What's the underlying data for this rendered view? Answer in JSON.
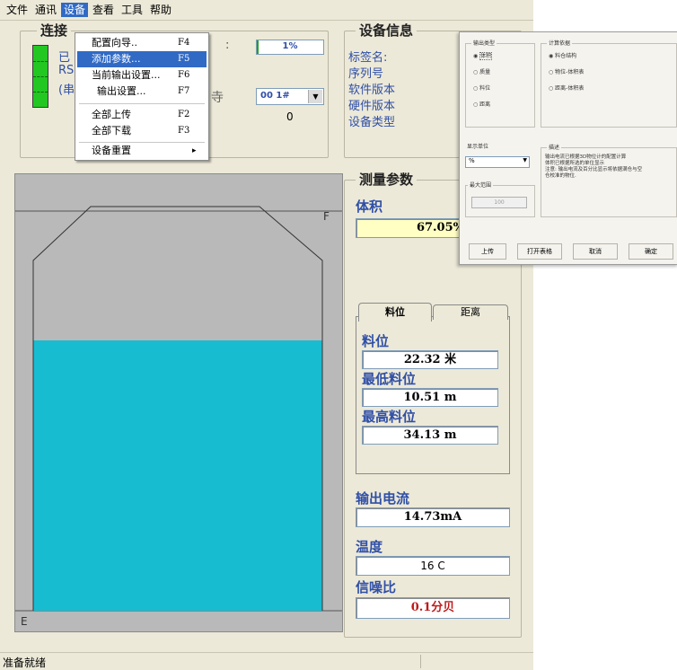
{
  "menubar": {
    "items": [
      "文件",
      "通讯",
      "设备",
      "查看",
      "工具",
      "帮助"
    ]
  },
  "device_menu": {
    "items": [
      {
        "label": "配置向导..",
        "key": "F4"
      },
      {
        "label": "添加参数...",
        "key": "F5"
      },
      {
        "label": "当前输出设置...",
        "key": "F6"
      },
      {
        "label": "输出设置...",
        "key": "F7"
      },
      {
        "label": "全部上传",
        "key": "F2"
      },
      {
        "label": "全部下载",
        "key": "F3"
      },
      {
        "label": "设备重置",
        "key": "▸"
      }
    ]
  },
  "connection": {
    "title": "连接",
    "line1": "已",
    "line2": "RS",
    "line3": "(串",
    "progress_text": "1%",
    "device_select": "00 1#",
    "count": "0",
    "colon": ":",
    "char": "寺"
  },
  "device_info": {
    "title": "设备信息",
    "labels": [
      "标签名:",
      "序列号",
      "软件版本",
      "硬件版本",
      "设备类型"
    ]
  },
  "tank": {
    "full_label": "F",
    "empty_label": "E",
    "level_fraction": 0.67
  },
  "measurements": {
    "title": "测量参数",
    "volume_label": "体积",
    "volume_value": "67.05%",
    "tabs": [
      "料位",
      "距离"
    ],
    "level_label": "料位",
    "level_value": "22.32 米",
    "min_level_label": "最低料位",
    "min_level_value": "10.51 m",
    "max_level_label": "最高料位",
    "max_level_value": "34.13 m",
    "current_label": "输出电流",
    "current_value": "14.73mA",
    "temp_label": "温度",
    "temp_value": "16 C",
    "snr_label": "信噪比",
    "snr_value": "0.1分贝"
  },
  "dialog": {
    "output_type_title": "输出类型",
    "output_types": [
      "体积",
      "质量",
      "料位",
      "距离"
    ],
    "calc_title": "计算依据",
    "calc_options": [
      "料仓结构",
      "物位-体积表",
      "距离-体积表"
    ],
    "unit_title": "显示单位",
    "unit_value": "%",
    "max_range_title": "最大范围",
    "max_range_value": "100",
    "desc_title": "描述",
    "desc_lines": [
      "输出电流已根据3D物位计的配置计算",
      "体积已根据所选的单位显示",
      "注意: 输出电流及百分比显示将依据满仓与空",
      "仓校准的物位."
    ],
    "buttons": [
      "上传",
      "打开表格",
      "取消",
      "确定"
    ]
  },
  "status": {
    "text": "准备就绪"
  }
}
